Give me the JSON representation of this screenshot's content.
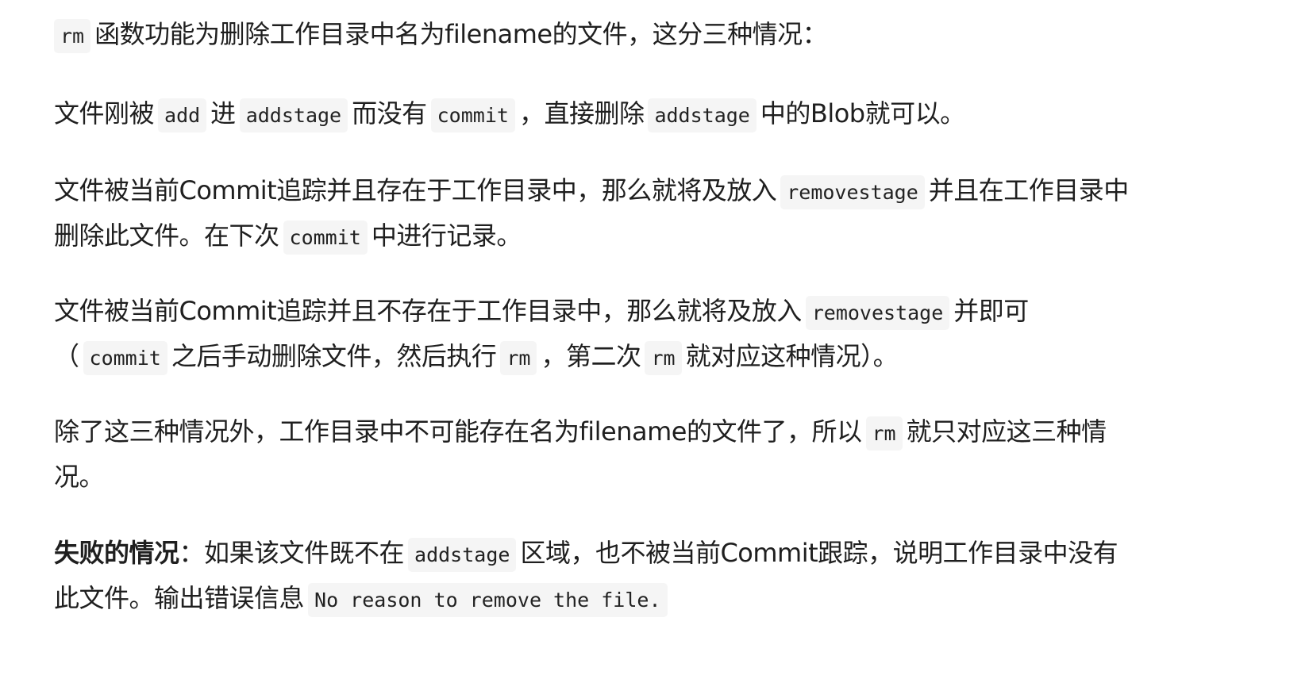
{
  "paragraphs": {
    "intro": {
      "code": "rm",
      "text": "函数功能为删除工作目录中名为filename的文件，这分三种情况："
    },
    "case1": {
      "t1": "文件刚被",
      "c1": "add",
      "t2": "进",
      "c2": "addstage",
      "t3": "而没有",
      "c3": "commit",
      "t4": "，直接删除",
      "c4": "addstage",
      "t5": "中的Blob就可以。"
    },
    "case2": {
      "t1": "文件被当前Commit追踪并且存在于工作目录中，那么就将及放入",
      "c1": "removestage",
      "t2": "并且在工作目录中",
      "t3": "删除此文件。在下次",
      "c2": "commit",
      "t4": "中进行记录。"
    },
    "case3": {
      "t1": "文件被当前Commit追踪并且不存在于工作目录中，那么就将及放入",
      "c1": "removestage",
      "t2": "并即可",
      "t3": "（",
      "c2": "commit",
      "t4": "之后手动删除文件，然后执行",
      "c3": "rm",
      "t5": "，第二次",
      "c4": "rm",
      "t6": "就对应这种情况）。"
    },
    "summary": {
      "t1": "除了这三种情况外，工作目录中不可能存在名为filename的文件了，所以",
      "c1": "rm",
      "t2": "就只对应这三种情",
      "t3": "况。"
    },
    "failure": {
      "bold": "失败的情况",
      "t1": "：如果该文件既不在",
      "c1": "addstage",
      "t2": "区域，也不被当前Commit跟踪，说明工作目录中没有",
      "t3": "此文件。输出错误信息",
      "c2": "No reason to remove the file."
    }
  }
}
